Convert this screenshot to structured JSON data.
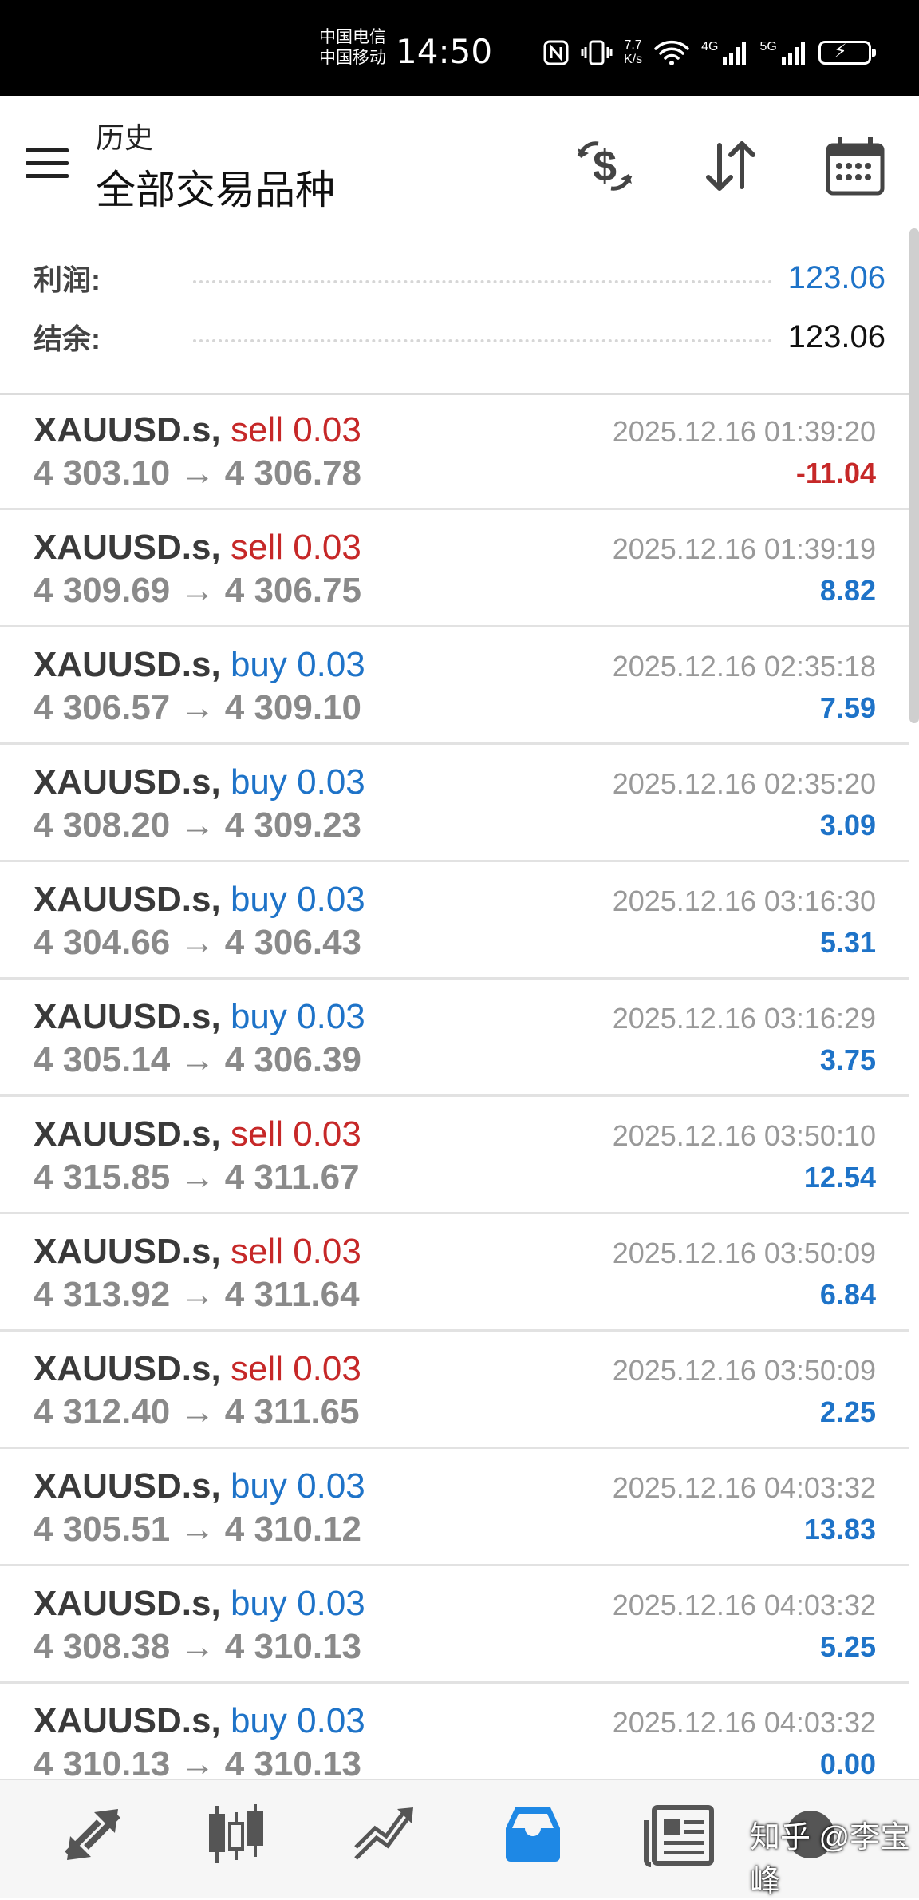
{
  "status": {
    "carrier1": "中国电信",
    "carrier2": "中国移动",
    "time": "14:50",
    "net_speed_value": "7.7",
    "net_speed_unit": "K/s",
    "sig1": "4G",
    "sig2": "5G"
  },
  "header": {
    "subtitle": "历史",
    "title": "全部交易品种"
  },
  "summary": {
    "profit_label": "利润:",
    "profit_value": "123.06",
    "balance_label": "结余:",
    "balance_value": "123.06"
  },
  "colors": {
    "sell": "#c62828",
    "buy": "#1e73c8",
    "accent": "#1e73c8",
    "negative": "#c62828"
  },
  "trades": [
    {
      "symbol": "XAUUSD.s,",
      "side": "sell 0.03",
      "open": "4 303.10",
      "arrow": "→",
      "close": "4 306.78",
      "time": "2025.12.16 01:39:20",
      "profit": "-11.04",
      "type": "sell",
      "neg": true
    },
    {
      "symbol": "XAUUSD.s,",
      "side": "sell 0.03",
      "open": "4 309.69",
      "arrow": "→",
      "close": "4 306.75",
      "time": "2025.12.16 01:39:19",
      "profit": "8.82",
      "type": "sell",
      "neg": false
    },
    {
      "symbol": "XAUUSD.s,",
      "side": "buy 0.03",
      "open": "4 306.57",
      "arrow": "→",
      "close": "4 309.10",
      "time": "2025.12.16 02:35:18",
      "profit": "7.59",
      "type": "buy",
      "neg": false
    },
    {
      "symbol": "XAUUSD.s,",
      "side": "buy 0.03",
      "open": "4 308.20",
      "arrow": "→",
      "close": "4 309.23",
      "time": "2025.12.16 02:35:20",
      "profit": "3.09",
      "type": "buy",
      "neg": false
    },
    {
      "symbol": "XAUUSD.s,",
      "side": "buy 0.03",
      "open": "4 304.66",
      "arrow": "→",
      "close": "4 306.43",
      "time": "2025.12.16 03:16:30",
      "profit": "5.31",
      "type": "buy",
      "neg": false
    },
    {
      "symbol": "XAUUSD.s,",
      "side": "buy 0.03",
      "open": "4 305.14",
      "arrow": "→",
      "close": "4 306.39",
      "time": "2025.12.16 03:16:29",
      "profit": "3.75",
      "type": "buy",
      "neg": false
    },
    {
      "symbol": "XAUUSD.s,",
      "side": "sell 0.03",
      "open": "4 315.85",
      "arrow": "→",
      "close": "4 311.67",
      "time": "2025.12.16 03:50:10",
      "profit": "12.54",
      "type": "sell",
      "neg": false
    },
    {
      "symbol": "XAUUSD.s,",
      "side": "sell 0.03",
      "open": "4 313.92",
      "arrow": "→",
      "close": "4 311.64",
      "time": "2025.12.16 03:50:09",
      "profit": "6.84",
      "type": "sell",
      "neg": false
    },
    {
      "symbol": "XAUUSD.s,",
      "side": "sell 0.03",
      "open": "4 312.40",
      "arrow": "→",
      "close": "4 311.65",
      "time": "2025.12.16 03:50:09",
      "profit": "2.25",
      "type": "sell",
      "neg": false
    },
    {
      "symbol": "XAUUSD.s,",
      "side": "buy 0.03",
      "open": "4 305.51",
      "arrow": "→",
      "close": "4 310.12",
      "time": "2025.12.16 04:03:32",
      "profit": "13.83",
      "type": "buy",
      "neg": false
    },
    {
      "symbol": "XAUUSD.s,",
      "side": "buy 0.03",
      "open": "4 308.38",
      "arrow": "→",
      "close": "4 310.13",
      "time": "2025.12.16 04:03:32",
      "profit": "5.25",
      "type": "buy",
      "neg": false
    },
    {
      "symbol": "XAUUSD.s,",
      "side": "buy 0.03",
      "open": "4 310.13",
      "arrow": "→",
      "close": "4 310.13",
      "time": "2025.12.16 04:03:32",
      "profit": "0.00",
      "type": "buy",
      "neg": false
    }
  ],
  "nav": {
    "items": [
      "quotes-icon",
      "chart-icon",
      "trade-icon",
      "history-icon",
      "news-icon"
    ],
    "active": 3
  },
  "watermark": "知乎 @李宝峰"
}
